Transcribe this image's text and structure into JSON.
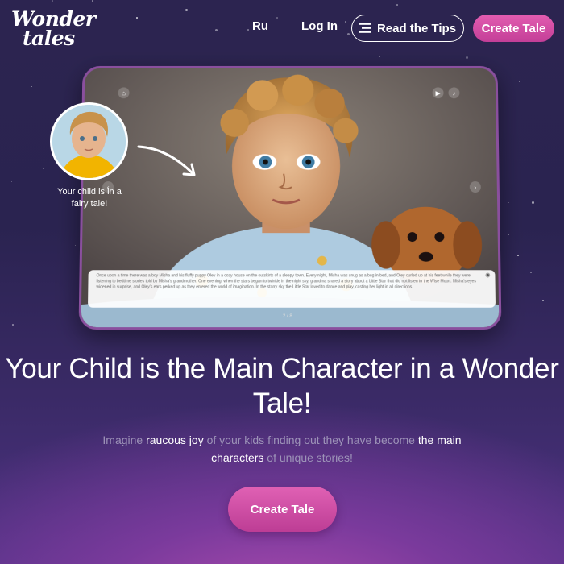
{
  "header": {
    "logo_line1": "Wonder",
    "logo_line2": "tales",
    "lang_label": "Ru",
    "login_label": "Log In",
    "tips_label": "Read the Tips",
    "create_label": "Create Tale"
  },
  "showcase": {
    "avatar_caption": "Your child is in a fairy tale!",
    "story_text": "Once upon a time there was a boy Misha and his fluffy puppy Oley in a cozy house on the outskirts of a sleepy town. Every night, Misha was snug as a bug in bed, and Oley curled up at his feet while they were listening to bedtime stories told by Misha's grandmother. One evening, when the stars began to twinkle in the night sky, grandma shared a story about a Little Star that did not listen to the Wise Moon. Misha's eyes widened in surprise, and Oley's ears perked up as they entered the world of imagination. In the starry sky the Little Star loved to dance and play, casting her light in all directions.",
    "page_indicator": "2 / 8"
  },
  "hero": {
    "title": "Your Child is the Main Character in a Wonder Tale!",
    "sub_part1": "Imagine ",
    "sub_hl1": "raucous joy",
    "sub_part2": " of your kids finding out they have become ",
    "sub_hl2": "the main characters",
    "sub_part3": " of unique stories!",
    "cta_label": "Create Tale"
  },
  "colors": {
    "accent_pink": "#d44fa6",
    "background_dark": "#2b2350",
    "subtitle_gray": "#9d93b8"
  },
  "icons": [
    "home-icon",
    "play-icon",
    "music-icon",
    "chevron-left-icon",
    "chevron-right-icon",
    "eye-icon",
    "menu-icon",
    "arrow-icon"
  ]
}
